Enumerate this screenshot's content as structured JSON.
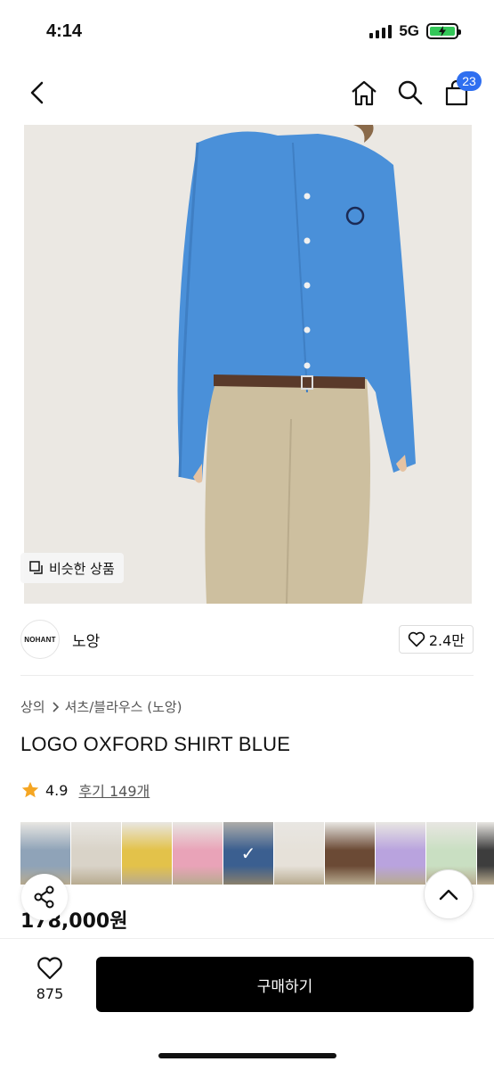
{
  "status_bar": {
    "time": "4:14",
    "network": "5G"
  },
  "nav": {
    "cart_count": "23"
  },
  "image_overlay": {
    "similar_label": "비슷한 상품"
  },
  "brand": {
    "logo_text": "NOHANT",
    "name": "노앙",
    "likes": "2.4만"
  },
  "breadcrumb": {
    "category": "상의",
    "subcategory": "셔츠/블라우스 (노앙)"
  },
  "product": {
    "title": "LOGO OXFORD SHIRT BLUE",
    "rating": "4.9",
    "reviews": "후기 149개",
    "price": "178,000원"
  },
  "color_options": [
    {
      "color": "#8fa3b8"
    },
    {
      "color": "#d9d3c8"
    },
    {
      "color": "#e3c24a"
    },
    {
      "color": "#e9a3b8"
    },
    {
      "color": "#4f7fc0",
      "selected": true
    },
    {
      "color": "#e6e1d9"
    },
    {
      "color": "#6b4a35"
    },
    {
      "color": "#b9a3de"
    },
    {
      "color": "#c9dfc2"
    },
    {
      "color": "#3d3d3d"
    }
  ],
  "bottom_bar": {
    "wish_count": "875",
    "buy_label": "구매하기"
  },
  "colors": {
    "accent": "#2f6ff0",
    "star": "#f5a623",
    "shirt": "#4a90d9",
    "pants": "#cdbf9f"
  }
}
